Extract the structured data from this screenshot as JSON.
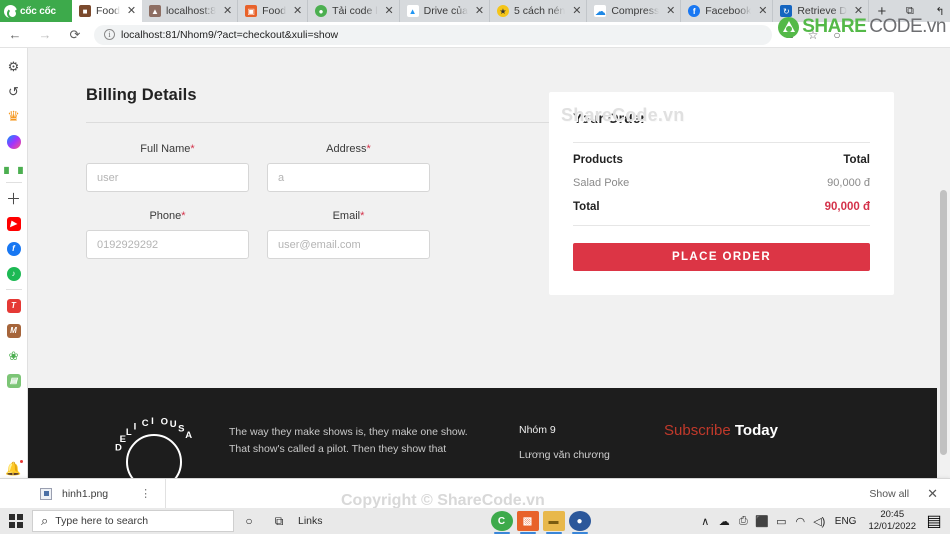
{
  "browser": {
    "brand": "cốc cốc",
    "tabs": [
      {
        "label": "Food",
        "icon": "food-favicon",
        "color": "#7b4a2d",
        "glyph": "■",
        "active": true
      },
      {
        "label": "localhost:8",
        "icon": "localhost-favicon",
        "color": "#8d6e63",
        "glyph": "▲",
        "active": false
      },
      {
        "label": "Food",
        "icon": "food2-favicon",
        "color": "#e8622a",
        "glyph": "▣",
        "active": false
      },
      {
        "label": "Tải code l",
        "icon": "download-favicon",
        "color": "#4caf50",
        "glyph": "●",
        "active": false
      },
      {
        "label": "Drive của",
        "icon": "drive-favicon",
        "color": "#2196f3",
        "glyph": "▲",
        "active": false
      },
      {
        "label": "5 cách nén",
        "icon": "compress-favicon",
        "color": "#f5c518",
        "glyph": "★",
        "active": false
      },
      {
        "label": "Compress",
        "icon": "cloud-favicon",
        "color": "#1e88e5",
        "glyph": "☁",
        "active": false
      },
      {
        "label": "Facebook",
        "icon": "facebook-favicon",
        "color": "#1877f2",
        "glyph": "f",
        "active": false
      },
      {
        "label": "Retrieve D",
        "icon": "retrieve-favicon",
        "color": "#1565c0",
        "glyph": "↻",
        "active": false
      }
    ],
    "new_tab_label": "+",
    "window_controls": {
      "screenshot": "⧉",
      "restore_session": "↰",
      "minimize": "–",
      "maximize": "❐",
      "close": "✕"
    },
    "nav": {
      "back": "←",
      "forward": "→",
      "reload": "⟳",
      "info": "i",
      "url": "localhost:81/Nhom9/?act=checkout&xuli=show",
      "translate": "⧉",
      "bookmark": "☆",
      "profile": "○"
    },
    "logo": {
      "share": "SHARE",
      "code": "CODE.vn"
    }
  },
  "sidebar": {
    "items": [
      {
        "name": "settings-icon",
        "glyph": "⚙",
        "color": "#4a4a4a"
      },
      {
        "name": "history-icon",
        "glyph": "↺",
        "color": "#4a4a4a"
      },
      {
        "name": "crown-icon",
        "glyph": "♛",
        "color": "#f5971d"
      },
      {
        "name": "messenger-icon",
        "glyph": "⚡",
        "color": "#8a2be2"
      },
      {
        "name": "game-controller-icon",
        "glyph": "❖",
        "color": "#4caf50"
      },
      {
        "name": "add-icon",
        "glyph": "＋",
        "color": "#4a4a4a"
      },
      {
        "name": "youtube-icon",
        "glyph": "▶",
        "color": "#ff0000"
      },
      {
        "name": "facebook-icon",
        "glyph": "f",
        "color": "#1877f2"
      },
      {
        "name": "spotify-icon",
        "glyph": "♫",
        "color": "#1db954"
      },
      {
        "name": "tet-app-icon",
        "glyph": "T",
        "color": "#e53935"
      },
      {
        "name": "tiki-icon",
        "glyph": "M",
        "color": "#a6653b"
      },
      {
        "name": "tennis-icon",
        "glyph": "❀",
        "color": "#4caf50"
      },
      {
        "name": "shop-icon",
        "glyph": "▤",
        "color": "#4caf50"
      }
    ],
    "bell": "ὑ4",
    "more": "…"
  },
  "page": {
    "watermark_top": "ShareCode.vn",
    "watermark_bottom": "Copyright © ShareCode.vn",
    "billing": {
      "title": "Billing Details",
      "fields": [
        {
          "label": "Full Name",
          "required": "*",
          "placeholder": "user",
          "value": ""
        },
        {
          "label": "Address",
          "required": "*",
          "placeholder": "a",
          "value": ""
        },
        {
          "label": "Phone",
          "required": "*",
          "placeholder": "0192929292",
          "value": ""
        },
        {
          "label": "Email",
          "required": "*",
          "placeholder": "user@email.com",
          "value": ""
        }
      ]
    },
    "order": {
      "title": "Your Order",
      "header_products": "Products",
      "header_total": "Total",
      "items": [
        {
          "name": "Salad Poke",
          "price": "90,000 đ"
        }
      ],
      "total_label": "Total",
      "total_value": "90,000 đ",
      "place_order_label": "PLACE ORDER",
      "accent_color": "#dc3545"
    },
    "footer": {
      "brand_circle": "DELICIOUSA",
      "about_line1": "The way they make shows is, they make one show.",
      "about_line2": "That show's called a pilot. Then they show that",
      "nav_heading": "Nhóm 9",
      "nav_link1": "Lương văn chương",
      "subscribe_red": "Subscribe",
      "subscribe_dark": "Today"
    }
  },
  "downloads": {
    "file_name": "hinh1.png",
    "kebab": "⋮",
    "show_all": "Show all",
    "close": "✕"
  },
  "taskbar": {
    "search_placeholder": "Type here to search",
    "search_icon": "⌕",
    "cortana_icon": "○",
    "taskview_icon": "⧉",
    "links_label": "Links",
    "apps": [
      {
        "name": "coccoc-taskbar-icon",
        "glyph": "C",
        "color": "#3daa4b",
        "open": true
      },
      {
        "name": "editor-taskbar-icon",
        "glyph": "▧",
        "color": "#e8622a",
        "open": true
      },
      {
        "name": "folder-taskbar-icon",
        "glyph": "▬",
        "color": "#e8b84b",
        "open": true
      },
      {
        "name": "app-taskbar-icon",
        "glyph": "●",
        "color": "#2b579a",
        "open": true
      }
    ],
    "tray": [
      {
        "name": "show-hidden-icons",
        "glyph": "∧"
      },
      {
        "name": "onedrive-icon",
        "glyph": "☁"
      },
      {
        "name": "printer-icon",
        "glyph": "⎙"
      },
      {
        "name": "usb-icon",
        "glyph": "⬛"
      },
      {
        "name": "battery-icon",
        "glyph": "▭"
      },
      {
        "name": "wifi-icon",
        "glyph": "◠"
      },
      {
        "name": "volume-icon",
        "glyph": "◁)"
      }
    ],
    "language": "ENG",
    "time": "20:45",
    "date": "12/01/2022",
    "action_center": "▤"
  }
}
